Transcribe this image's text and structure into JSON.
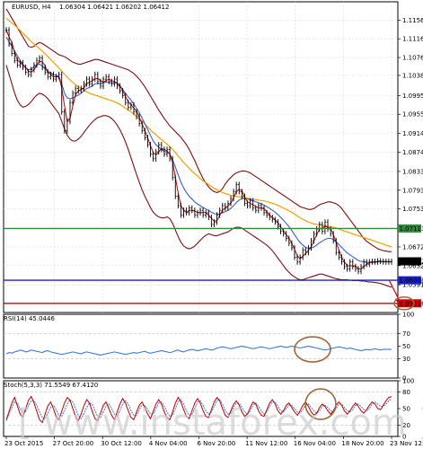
{
  "chart_data": [
    {
      "type": "line",
      "title": "EURUSD, H4",
      "ohlc_label": "1.06304 1.06421 1.06202 1.06412",
      "y_ticks": [
        "1.11560",
        "1.11160",
        "1.10760",
        "1.10380",
        "1.09950",
        "1.09550",
        "1.09140",
        "1.08740",
        "1.08330",
        "1.07930",
        "1.07530",
        "1.06720",
        "1.06320",
        "1.05910"
      ],
      "ylim": [
        1.0532,
        1.1195
      ],
      "x_tick_labels": [
        "23 Oct 2015",
        "27 Oct 20:00",
        "30 Oct 12:00",
        "4 Nov 04:00",
        "6 Nov 20:00",
        "11 Nov 12:00",
        "16 Nov 04:00",
        "18 Nov 20:00",
        "23 Nov 12:00"
      ],
      "x_count": 140,
      "grid": true,
      "price": [
        1.1135,
        1.1105,
        1.1085,
        1.107,
        1.106,
        1.1065,
        1.1055,
        1.1045,
        1.104,
        1.105,
        1.106,
        1.107,
        1.1075,
        1.1055,
        1.1045,
        1.1035,
        1.104,
        1.103,
        1.1035,
        1.104,
        1.096,
        1.092,
        1.094,
        1.098,
        1.1,
        1.101,
        1.1005,
        1.101,
        1.102,
        1.103,
        1.102,
        1.103,
        1.104,
        1.1025,
        1.1015,
        1.103,
        1.1035,
        1.1025,
        1.102,
        1.103,
        1.1015,
        1.1005,
        1.0995,
        1.098,
        1.097,
        1.0975,
        1.096,
        1.095,
        1.0935,
        1.092,
        1.0905,
        1.089,
        1.087,
        1.086,
        1.0875,
        1.089,
        1.088,
        1.087,
        1.088,
        1.086,
        1.082,
        1.078,
        1.076,
        1.074,
        1.075,
        1.0745,
        1.0755,
        1.075,
        1.074,
        1.0745,
        1.075,
        1.074,
        1.0745,
        1.0735,
        1.072,
        1.0725,
        1.074,
        1.075,
        1.076,
        1.0755,
        1.0765,
        1.0775,
        1.079,
        1.0805,
        1.079,
        1.078,
        1.0765,
        1.076,
        1.077,
        1.0755,
        1.075,
        1.076,
        1.0755,
        1.0745,
        1.074,
        1.0735,
        1.073,
        1.0725,
        1.0715,
        1.0705,
        1.07,
        1.069,
        1.068,
        1.067,
        1.065,
        1.064,
        1.065,
        1.0665,
        1.066,
        1.067,
        1.0685,
        1.07,
        1.071,
        1.072,
        1.0705,
        1.0725,
        1.071,
        1.07,
        1.0685,
        1.066,
        1.065,
        1.064,
        1.063,
        1.0625,
        1.064,
        1.063,
        1.0625,
        1.062,
        1.063,
        1.064,
        1.0635,
        1.064,
        1.0641,
        1.064,
        1.0642,
        1.0641,
        1.064,
        1.0641,
        1.064,
        1.0641
      ],
      "ma_fast": [
        1.112,
        1.111,
        1.11,
        1.109,
        1.108,
        1.107,
        1.1062,
        1.1055,
        1.105,
        1.1052,
        1.1056,
        1.106,
        1.1062,
        1.1058,
        1.1052,
        1.1046,
        1.1044,
        1.104,
        1.1038,
        1.1036,
        1.102,
        1.1,
        1.099,
        1.0988,
        1.099,
        1.0993,
        1.0996,
        1.1,
        1.1005,
        1.101,
        1.1012,
        1.1015,
        1.102,
        1.1021,
        1.102,
        1.1022,
        1.1024,
        1.1023,
        1.1022,
        1.1023,
        1.102,
        1.1015,
        1.1008,
        1.1,
        1.0992,
        1.0985,
        1.0977,
        1.0968,
        1.0958,
        1.0947,
        1.0935,
        1.0923,
        1.091,
        1.0898,
        1.089,
        1.0885,
        1.088,
        1.0876,
        1.0874,
        1.087,
        1.0858,
        1.0842,
        1.0826,
        1.081,
        1.0798,
        1.0788,
        1.078,
        1.0774,
        1.0768,
        1.0763,
        1.076,
        1.0756,
        1.0753,
        1.075,
        1.0746,
        1.0743,
        1.0742,
        1.0743,
        1.0745,
        1.0747,
        1.075,
        1.0754,
        1.076,
        1.0767,
        1.0772,
        1.0775,
        1.0775,
        1.0774,
        1.0773,
        1.0771,
        1.0768,
        1.0766,
        1.0764,
        1.0761,
        1.0758,
        1.0754,
        1.075,
        1.0746,
        1.0741,
        1.0735,
        1.0729,
        1.0722,
        1.0715,
        1.0707,
        1.0698,
        1.0689,
        1.0681,
        1.0676,
        1.0671,
        1.0669,
        1.0669,
        1.0672,
        1.0676,
        1.0681,
        1.0684,
        1.0688,
        1.069,
        1.069,
        1.0688,
        1.0683,
        1.0677,
        1.0671,
        1.0665,
        1.0659,
        1.0655,
        1.0651,
        1.0647,
        1.0643,
        1.0641,
        1.064,
        1.0639,
        1.0639,
        1.0639,
        1.0639,
        1.064,
        1.064,
        1.064,
        1.064,
        1.064,
        1.064
      ],
      "ma_slow": [
        1.116,
        1.1155,
        1.115,
        1.1145,
        1.114,
        1.1134,
        1.1128,
        1.1122,
        1.1116,
        1.111,
        1.1105,
        1.11,
        1.1095,
        1.109,
        1.1084,
        1.1078,
        1.1072,
        1.1066,
        1.106,
        1.1054,
        1.1047,
        1.104,
        1.1034,
        1.1028,
        1.1023,
        1.1018,
        1.1014,
        1.101,
        1.1006,
        1.1003,
        1.1,
        1.0998,
        1.0996,
        1.0994,
        1.0992,
        1.099,
        1.0988,
        1.0986,
        1.0984,
        1.0982,
        1.0979,
        1.0976,
        1.0972,
        1.0968,
        1.0964,
        1.096,
        1.0955,
        1.095,
        1.0945,
        1.094,
        1.0934,
        1.0928,
        1.0922,
        1.0916,
        1.0911,
        1.0906,
        1.0901,
        1.0896,
        1.0891,
        1.0886,
        1.088,
        1.0873,
        1.0866,
        1.0859,
        1.0852,
        1.0846,
        1.084,
        1.0834,
        1.0828,
        1.0823,
        1.0818,
        1.0813,
        1.0809,
        1.0805,
        1.0801,
        1.0797,
        1.0794,
        1.0791,
        1.0788,
        1.0786,
        1.0784,
        1.0782,
        1.0781,
        1.078,
        1.0779,
        1.0778,
        1.0777,
        1.0776,
        1.0775,
        1.0774,
        1.0773,
        1.0772,
        1.0771,
        1.077,
        1.0769,
        1.0767,
        1.0765,
        1.0763,
        1.0761,
        1.0758,
        1.0755,
        1.0752,
        1.0749,
        1.0746,
        1.0742,
        1.0738,
        1.0734,
        1.0731,
        1.0728,
        1.0725,
        1.0723,
        1.0721,
        1.072,
        1.0719,
        1.0718,
        1.0717,
        1.0716,
        1.0715,
        1.0714,
        1.0712,
        1.071,
        1.0708,
        1.0706,
        1.0704,
        1.0702,
        1.07,
        1.0698,
        1.0696,
        1.0694,
        1.0692,
        1.069,
        1.0688,
        1.0686,
        1.0684,
        1.0682,
        1.068,
        1.0678,
        1.0676,
        1.0674,
        1.0672
      ],
      "bb_upper": [
        1.118,
        1.117,
        1.116,
        1.115,
        1.114,
        1.113,
        1.112,
        1.111,
        1.11,
        1.1098,
        1.11,
        1.1105,
        1.1108,
        1.1106,
        1.1102,
        1.1098,
        1.1094,
        1.109,
        1.1086,
        1.1082,
        1.108,
        1.1078,
        1.1074,
        1.107,
        1.1066,
        1.1064,
        1.1062,
        1.1062,
        1.1064,
        1.1066,
        1.1068,
        1.107,
        1.1072,
        1.1072,
        1.107,
        1.1068,
        1.1066,
        1.1064,
        1.1062,
        1.106,
        1.1058,
        1.1056,
        1.1054,
        1.1052,
        1.105,
        1.1046,
        1.1042,
        1.1036,
        1.103,
        1.1022,
        1.1014,
        1.1004,
        1.0994,
        1.0984,
        1.0974,
        1.0964,
        1.0955,
        1.0946,
        1.0938,
        1.093,
        1.0924,
        1.0918,
        1.0912,
        1.0906,
        1.0898,
        1.089,
        1.088,
        1.0868,
        1.0856,
        1.0842,
        1.083,
        1.0818,
        1.0808,
        1.08,
        1.0794,
        1.079,
        1.0788,
        1.079,
        1.0796,
        1.0806,
        1.0814,
        1.082,
        1.0826,
        1.083,
        1.0832,
        1.0834,
        1.0834,
        1.0832,
        1.083,
        1.0826,
        1.0822,
        1.0818,
        1.0814,
        1.081,
        1.0806,
        1.0802,
        1.0798,
        1.0794,
        1.079,
        1.0786,
        1.0782,
        1.0778,
        1.0774,
        1.077,
        1.0766,
        1.0762,
        1.0758,
        1.0756,
        1.0754,
        1.0752,
        1.0752,
        1.0754,
        1.0758,
        1.0762,
        1.0764,
        1.0766,
        1.0768,
        1.0768,
        1.0766,
        1.0764,
        1.076,
        1.0754,
        1.0746,
        1.0738,
        1.073,
        1.0722,
        1.0714,
        1.0706,
        1.0698,
        1.069,
        1.0684,
        1.068,
        1.0676,
        1.0672,
        1.0668,
        1.0666,
        1.0664,
        1.0663,
        1.0662,
        1.0662
      ],
      "bb_lower": [
        1.106,
        1.104,
        1.102,
        1.1,
        1.0985,
        1.0975,
        1.097,
        1.0972,
        1.0976,
        1.0982,
        1.099,
        1.0996,
        1.1,
        1.0998,
        1.0994,
        1.0988,
        1.098,
        1.0972,
        1.0964,
        1.0956,
        1.094,
        1.0924,
        1.091,
        1.0902,
        1.0898,
        1.0898,
        1.0902,
        1.0908,
        1.0916,
        1.0924,
        1.0932,
        1.0938,
        1.0944,
        1.0948,
        1.095,
        1.0952,
        1.0952,
        1.095,
        1.0946,
        1.094,
        1.0932,
        1.0922,
        1.091,
        1.0896,
        1.088,
        1.0862,
        1.0844,
        1.0826,
        1.081,
        1.0794,
        1.078,
        1.0768,
        1.0756,
        1.0746,
        1.074,
        1.0736,
        1.0734,
        1.0734,
        1.0736,
        1.0732,
        1.0722,
        1.0708,
        1.0694,
        1.0682,
        1.0674,
        1.067,
        1.0668,
        1.067,
        1.0674,
        1.068,
        1.0686,
        1.0692,
        1.0697,
        1.07,
        1.0698,
        1.0696,
        1.0696,
        1.0698,
        1.07,
        1.0702,
        1.0704,
        1.0708,
        1.0712,
        1.0714,
        1.0714,
        1.0712,
        1.0708,
        1.0704,
        1.07,
        1.0696,
        1.0692,
        1.0688,
        1.0684,
        1.068,
        1.0676,
        1.067,
        1.0664,
        1.0656,
        1.0648,
        1.064,
        1.0632,
        1.0624,
        1.0618,
        1.0612,
        1.0608,
        1.0604,
        1.0602,
        1.0602,
        1.0604,
        1.0606,
        1.0608,
        1.061,
        1.0612,
        1.0614,
        1.0614,
        1.0612,
        1.061,
        1.0608,
        1.0606,
        1.0604,
        1.0603,
        1.0602,
        1.0602,
        1.0602,
        1.0601,
        1.06,
        1.06,
        1.06,
        1.0599,
        1.0599,
        1.0598,
        1.0597,
        1.0597,
        1.0596,
        1.0595,
        1.0594,
        1.0592,
        1.059,
        1.0588,
        1.0586
      ],
      "levels": [
        {
          "value": 1.07113,
          "label": "1.07113",
          "color": "#2e8b3a"
        },
        {
          "value": 1.06008,
          "label": "1.06008",
          "color": "#1a22cc"
        },
        {
          "value": 1.05516,
          "label": "1.05516",
          "color": "#d40000"
        }
      ],
      "current_price": {
        "value": 1.06412,
        "label": "1.06412"
      },
      "colors": {
        "candles": "#000000",
        "ma_fast": "#3a5fc8",
        "ma_slow": "#f0a000",
        "bands": "#7a1010",
        "price": "#c00000"
      }
    },
    {
      "type": "line",
      "title": "RSI(14) 45.0446",
      "y_ticks": [
        "100",
        "70",
        "50",
        "30",
        "0"
      ],
      "ylim": [
        0,
        100
      ],
      "values": [
        38,
        40,
        39,
        41,
        42,
        44,
        43,
        41,
        42,
        44,
        43,
        42,
        41,
        40,
        42,
        43,
        41,
        40,
        39,
        38,
        37,
        38,
        39,
        40,
        41,
        40,
        39,
        38,
        40,
        41,
        40,
        39,
        38,
        37,
        36,
        37,
        38,
        39,
        40,
        41,
        40,
        39,
        38,
        37,
        38,
        39,
        40,
        39,
        40,
        41,
        42,
        40,
        39,
        40,
        41,
        42,
        43,
        42,
        41,
        40,
        41,
        43,
        44,
        42,
        41,
        43,
        44,
        45,
        44,
        43,
        44,
        45,
        46,
        45,
        44,
        45,
        47,
        48,
        49,
        48,
        47,
        46,
        47,
        48,
        49,
        50,
        49,
        48,
        47,
        46,
        47,
        48,
        49,
        48,
        47,
        46,
        47,
        48,
        49,
        50,
        49,
        48,
        49,
        50,
        49,
        48,
        47,
        48,
        49,
        50,
        49,
        48,
        47,
        46,
        45,
        44,
        45,
        46,
        47,
        48,
        49,
        48,
        47,
        46,
        47,
        46,
        45,
        44,
        43,
        44,
        45,
        44,
        45,
        46,
        45,
        44,
        45,
        45,
        45,
        45
      ],
      "colors": {
        "line": "#3a7ad8"
      }
    },
    {
      "type": "line",
      "title": "Stoch(5,3,3) 71.5549 67.4120",
      "y_ticks": [
        "100",
        "80",
        "50",
        "20",
        "0"
      ],
      "ylim": [
        0,
        100
      ],
      "main": [
        30,
        45,
        60,
        70,
        55,
        40,
        35,
        50,
        65,
        72,
        60,
        45,
        30,
        25,
        40,
        55,
        62,
        50,
        35,
        30,
        45,
        60,
        70,
        65,
        50,
        35,
        28,
        40,
        55,
        66,
        60,
        45,
        32,
        28,
        42,
        56,
        62,
        50,
        38,
        30,
        44,
        58,
        68,
        60,
        46,
        34,
        30,
        44,
        56,
        62,
        52,
        40,
        32,
        45,
        58,
        66,
        58,
        44,
        34,
        30,
        44,
        60,
        70,
        62,
        48,
        36,
        32,
        46,
        60,
        68,
        60,
        46,
        36,
        34,
        48,
        62,
        70,
        64,
        50,
        38,
        34,
        46,
        58,
        64,
        56,
        44,
        36,
        40,
        52,
        62,
        58,
        46,
        38,
        36,
        48,
        60,
        66,
        58,
        46,
        40,
        46,
        56,
        60,
        52,
        44,
        38,
        46,
        56,
        62,
        54,
        44,
        38,
        42,
        52,
        58,
        54,
        46,
        40,
        46,
        56,
        62,
        56,
        46,
        40,
        46,
        54,
        60,
        54,
        46,
        42,
        48,
        56,
        62,
        58,
        50,
        48,
        56,
        64,
        70,
        71.5549
      ],
      "signal": [
        28,
        40,
        52,
        62,
        60,
        50,
        42,
        45,
        55,
        64,
        64,
        56,
        44,
        34,
        32,
        42,
        52,
        56,
        48,
        38,
        36,
        46,
        58,
        66,
        62,
        50,
        38,
        32,
        40,
        52,
        60,
        58,
        46,
        36,
        34,
        44,
        54,
        58,
        50,
        40,
        36,
        46,
        58,
        64,
        58,
        46,
        38,
        38,
        48,
        56,
        56,
        48,
        40,
        40,
        50,
        60,
        62,
        54,
        44,
        36,
        38,
        50,
        62,
        66,
        58,
        46,
        38,
        40,
        50,
        62,
        64,
        56,
        46,
        40,
        44,
        54,
        64,
        66,
        58,
        46,
        40,
        42,
        52,
        60,
        60,
        52,
        44,
        40,
        46,
        56,
        60,
        54,
        46,
        40,
        44,
        54,
        62,
        62,
        54,
        46,
        44,
        50,
        56,
        56,
        50,
        44,
        42,
        48,
        56,
        58,
        52,
        46,
        42,
        46,
        54,
        56,
        52,
        46,
        44,
        50,
        58,
        58,
        52,
        46,
        44,
        48,
        56,
        58,
        54,
        48,
        46,
        50,
        58,
        62,
        58,
        54,
        54,
        58,
        64,
        67.412
      ],
      "y_label_bottom": "0",
      "colors": {
        "main": "#c00000",
        "signal": "#3a7ad8"
      }
    }
  ],
  "watermark": "[ www.instaforex.com ]"
}
